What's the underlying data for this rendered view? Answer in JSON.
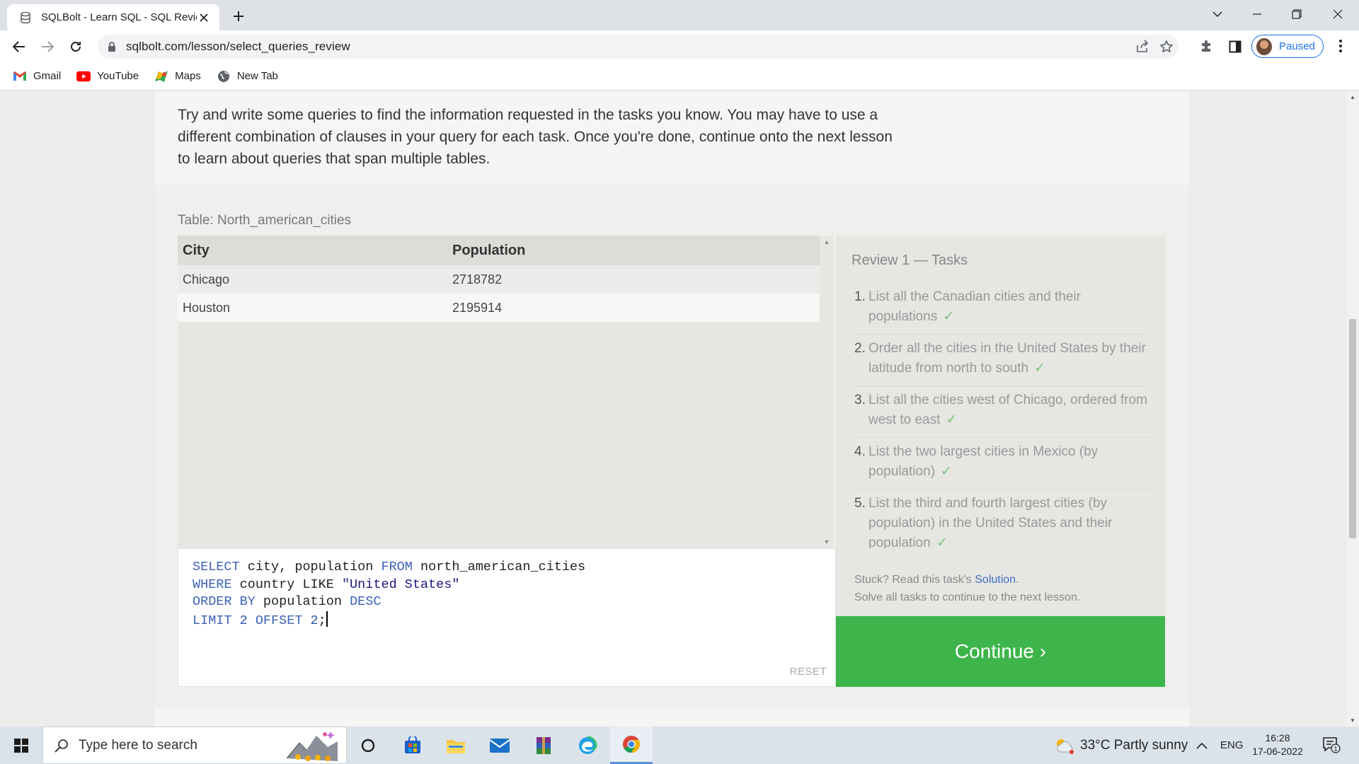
{
  "browser": {
    "tab_title": "SQLBolt - Learn SQL - SQL Review",
    "url": "sqlbolt.com/lesson/select_queries_review",
    "profile_label": "Paused",
    "bookmarks": [
      {
        "label": "Gmail",
        "icon": "gmail-icon"
      },
      {
        "label": "YouTube",
        "icon": "youtube-icon"
      },
      {
        "label": "Maps",
        "icon": "maps-icon"
      },
      {
        "label": "New Tab",
        "icon": "globe-icon"
      }
    ]
  },
  "lesson": {
    "intro": "Try and write some queries to find the information requested in the tasks you know. You may have to use a different combination of clauses in your query for each task. Once you're done, continue onto the next lesson to learn about queries that span multiple tables.",
    "table_label": "Table: North_american_cities",
    "table": {
      "headers": [
        "City",
        "Population"
      ],
      "rows": [
        [
          "Chicago",
          "2718782"
        ],
        [
          "Houston",
          "2195914"
        ]
      ]
    },
    "query": {
      "line1": {
        "k1": "SELECT",
        "t1": " city, population ",
        "k2": "FROM",
        "t2": " north_american_cities"
      },
      "line2": {
        "k1": "WHERE",
        "t1": " country LIKE ",
        "s1": "\"United States\""
      },
      "line3": {
        "k1": "ORDER BY",
        "t1": " population ",
        "k2": "DESC"
      },
      "line4": {
        "k1": "LIMIT",
        "n1": " 2 ",
        "k2": "OFFSET",
        "n2": " 2",
        "t1": ";"
      }
    },
    "reset_label": "RESET",
    "tasks_title": "Review 1 — Tasks",
    "tasks": [
      {
        "num": "1.",
        "text": "List all the Canadian cities and their populations",
        "check": "✓"
      },
      {
        "num": "2.",
        "text": "Order all the cities in the United States by their latitude from north to south",
        "check": "✓"
      },
      {
        "num": "3.",
        "text": "List all the cities west of Chicago, ordered from west to east",
        "check": "✓"
      },
      {
        "num": "4.",
        "text": "List the two largest cities in Mexico (by population)",
        "check": "✓"
      },
      {
        "num": "5.",
        "text": "List the third and fourth largest cities (by population) in the United States and their population",
        "check": "✓"
      }
    ],
    "stuck_prefix": "Stuck? Read this task's ",
    "solution_link": "Solution",
    "stuck_suffix": ".",
    "solve_all": "Solve all tasks to continue to the next lesson.",
    "continue_label": "Continue ›",
    "accent_color": "#3db54a"
  },
  "taskbar": {
    "search_placeholder": "Type here to search",
    "weather": "33°C  Partly sunny",
    "language": "ENG",
    "time": "16:28",
    "date": "17-06-2022",
    "notification_count": "1"
  }
}
